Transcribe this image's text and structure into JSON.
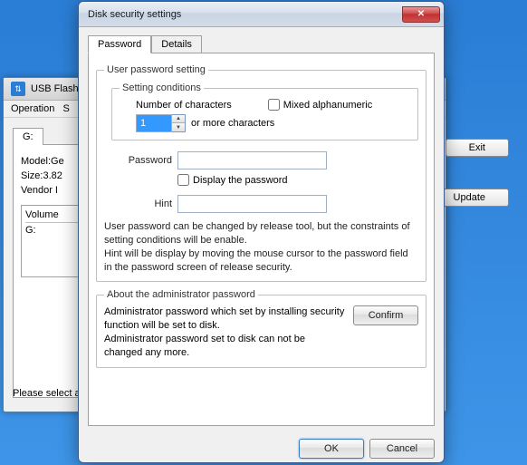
{
  "bg": {
    "title": "USB Flash S",
    "menu1": "Operation",
    "menu2": "S",
    "drive_tab": "G:",
    "model": "Model:Ge",
    "size": "Size:3.82",
    "vendor": "Vendor I",
    "vol_header": "Volume",
    "vol_item": "G:",
    "btn_exit": "Exit",
    "btn_update": "Update",
    "status": "Please select a "
  },
  "dlg": {
    "title": "Disk security settings",
    "tabs": {
      "password": "Password",
      "details": "Details"
    },
    "group_user": "User password setting",
    "group_cond": "Setting conditions",
    "label_numchars": "Number of characters",
    "numchars_value": "1",
    "label_ormore": "or more characters",
    "chk_mixed": "Mixed alphanumeric",
    "label_password": "Password",
    "password_value": "",
    "chk_display": "Display the password",
    "label_hint": "Hint",
    "hint_value": "",
    "help1": "User password can be changed by release tool, but the constraints of setting conditions will be enable.\nHint will be display by moving the mouse cursor to the password field in the password screen of release security.",
    "group_admin": "About the administrator password",
    "admin_text": "Administrator password which set by installing security function will be set to disk.\nAdministrator password set to disk can not be changed any more.",
    "btn_confirm": "Confirm",
    "btn_ok": "OK",
    "btn_cancel": "Cancel"
  }
}
